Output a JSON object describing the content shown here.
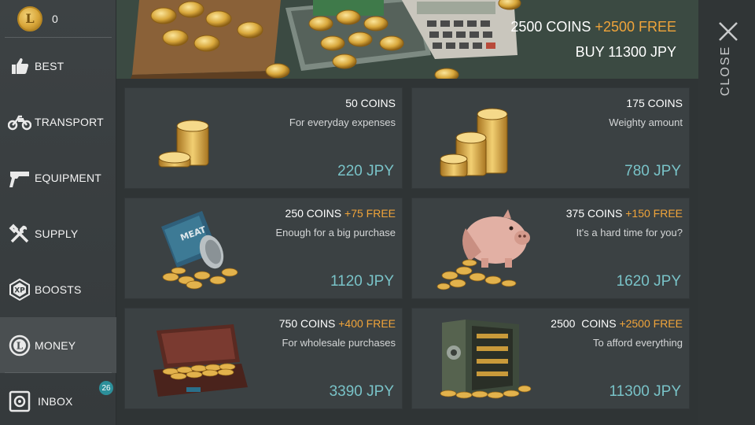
{
  "balance": {
    "value": "0"
  },
  "nav": [
    {
      "label": "BEST",
      "icon": "thumbs-up-icon"
    },
    {
      "label": "TRANSPORT",
      "icon": "motorcycle-icon"
    },
    {
      "label": "EQUIPMENT",
      "icon": "pistol-icon"
    },
    {
      "label": "SUPPLY",
      "icon": "tools-icon"
    },
    {
      "label": "BOOSTS",
      "icon": "xp-icon"
    },
    {
      "label": "MONEY",
      "icon": "coin-icon"
    },
    {
      "label": "INBOX",
      "icon": "safe-icon",
      "badge": "26"
    }
  ],
  "banner": {
    "coins": "2500  COINS",
    "free": "+2500 FREE",
    "buy": "BUY 11300 JPY"
  },
  "close": {
    "label": "CLOSE"
  },
  "offers": [
    {
      "coins": "50 COINS",
      "free": "",
      "desc": "For everyday expenses",
      "price": "220 JPY",
      "art": "small-coin-stack"
    },
    {
      "coins": "175 COINS",
      "free": "",
      "desc": "Weighty amount",
      "price": "780 JPY",
      "art": "large-coin-stack"
    },
    {
      "coins": "250 COINS",
      "free": "+75 FREE",
      "desc": "Enough for a big purchase",
      "price": "1120 JPY",
      "art": "coin-can"
    },
    {
      "coins": "375 COINS",
      "free": "+150 FREE",
      "desc": "It's a hard time for you?",
      "price": "1620 JPY",
      "art": "piggy-bank"
    },
    {
      "coins": "750 COINS",
      "free": "+400 FREE",
      "desc": "For wholesale purchases",
      "price": "3390 JPY",
      "art": "coin-suitcase"
    },
    {
      "coins": "2500  COINS",
      "free": "+2500 FREE",
      "desc": "To afford everything",
      "price": "11300 JPY",
      "art": "coin-safe"
    }
  ],
  "colors": {
    "free": "#f0a43a",
    "price": "#79c3c8",
    "badge": "#2c8f9a"
  }
}
